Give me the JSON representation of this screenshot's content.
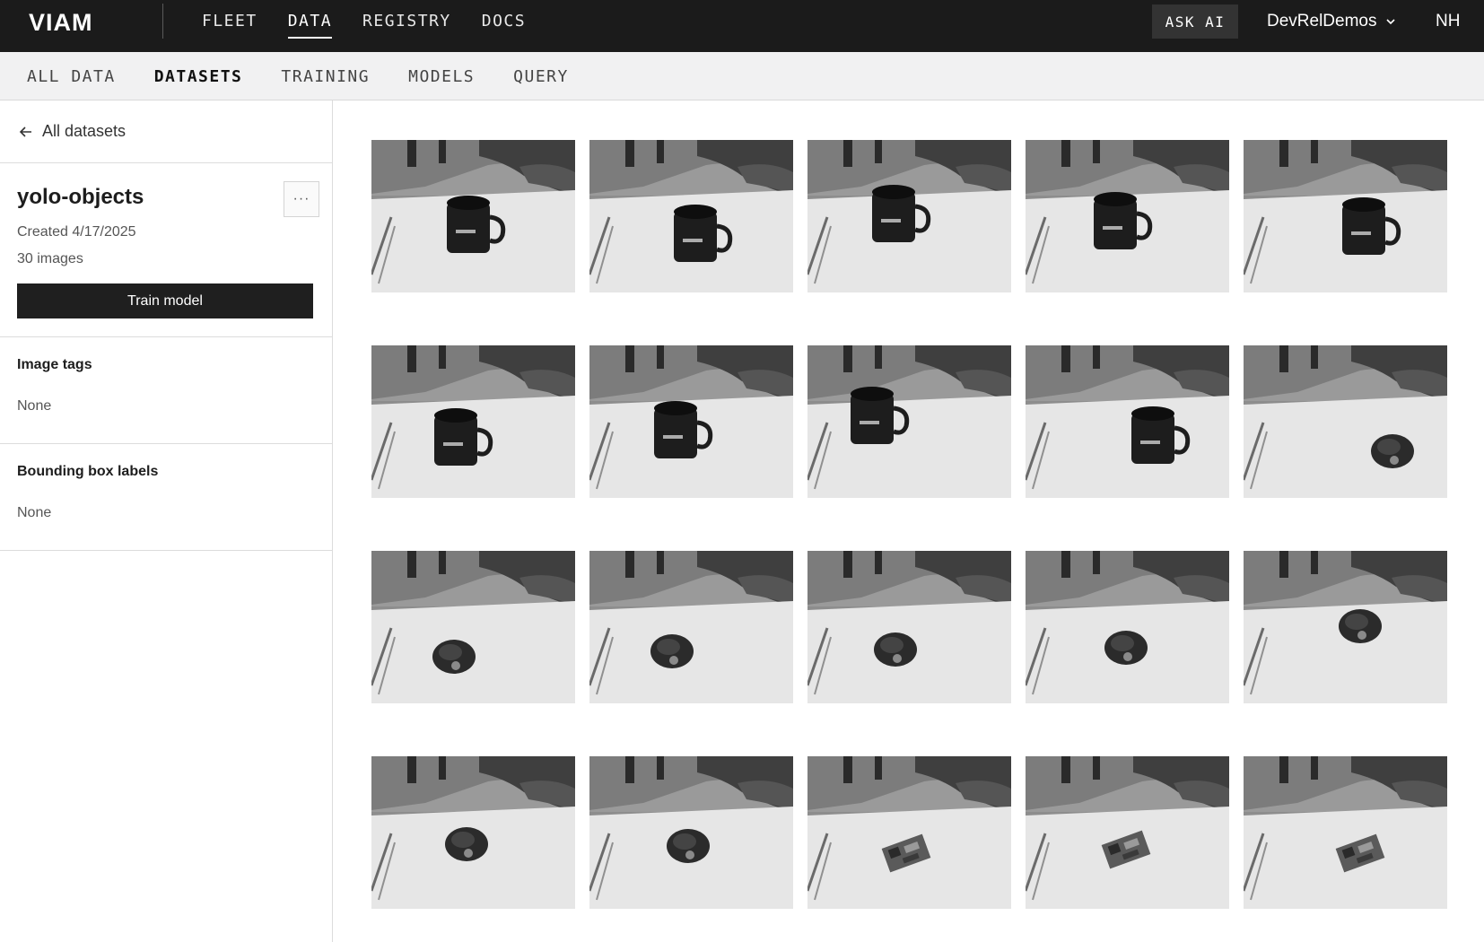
{
  "topbar": {
    "logo_text": "VIAM",
    "nav": [
      "FLEET",
      "DATA",
      "REGISTRY",
      "DOCS"
    ],
    "active_nav": "DATA",
    "ask_ai": "ASK AI",
    "org": "DevRelDemos",
    "avatar": "NH"
  },
  "subnav": {
    "items": [
      "ALL DATA",
      "DATASETS",
      "TRAINING",
      "MODELS",
      "QUERY"
    ],
    "active": "DATASETS"
  },
  "sidebar": {
    "back_label": "All datasets",
    "dataset_name": "yolo-objects",
    "more_label": "···",
    "created": "Created 4/17/2025",
    "count": "30 images",
    "train_button": "Train model",
    "image_tags_title": "Image tags",
    "image_tags_value": "None",
    "bbox_title": "Bounding box labels",
    "bbox_value": "None"
  },
  "icons": {
    "back": "arrow-left-icon",
    "org_dropdown": "chevron-down-icon",
    "more": "more-horizontal-icon"
  },
  "colors": {
    "topbar_bg": "#1b1b1b",
    "subbar_bg": "#f1f1f2",
    "button_bg": "#1f1f1f"
  },
  "gallery": {
    "thumbnails": [
      {
        "object": "mug"
      },
      {
        "object": "mug"
      },
      {
        "object": "mug"
      },
      {
        "object": "mug"
      },
      {
        "object": "mug"
      },
      {
        "object": "mug"
      },
      {
        "object": "mug"
      },
      {
        "object": "mug"
      },
      {
        "object": "mug"
      },
      {
        "object": "device"
      },
      {
        "object": "device"
      },
      {
        "object": "device"
      },
      {
        "object": "device"
      },
      {
        "object": "device"
      },
      {
        "object": "device"
      },
      {
        "object": "device"
      },
      {
        "object": "device"
      },
      {
        "object": "board"
      },
      {
        "object": "board"
      },
      {
        "object": "board"
      }
    ]
  }
}
